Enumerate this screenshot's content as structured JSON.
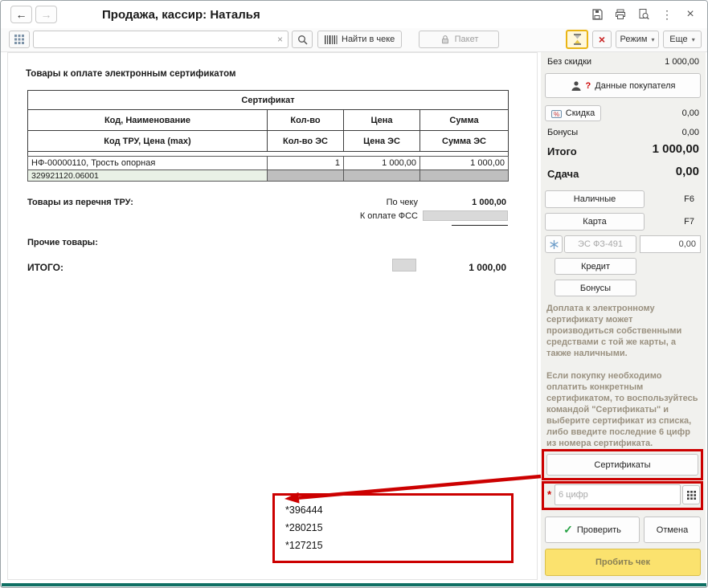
{
  "titlebar": {
    "back_glyph": "←",
    "forward_glyph": "→",
    "title": "Продажа, кассир: Наталья",
    "kebab_glyph": "⋮",
    "close_glyph": "×"
  },
  "toolbar": {
    "clear_glyph": "×",
    "find_button": "Найти в чеке",
    "package_button": "Пакет",
    "cancel_glyph": "×",
    "mode_button": "Режим",
    "more_button": "Еще",
    "dropdown_glyph": "▾"
  },
  "main": {
    "heading": "Товары к оплате электронным сертификатом",
    "table": {
      "group_header": "Сертификат",
      "header_row1": [
        "Код, Наименование",
        "Кол-во",
        "Цена",
        "Сумма"
      ],
      "header_row2": [
        "Код ТРУ, Цена (max)",
        "Кол-во ЭС",
        "Цена ЭС",
        "Сумма ЭС"
      ],
      "row": {
        "name": "НФ-00000110, Трость опорная",
        "qty": "1",
        "price": "1 000,00",
        "sum": "1 000,00"
      },
      "code_row": {
        "code": "329921120.06001"
      }
    },
    "tru_section": {
      "label": "Товары из перечня ТРУ:",
      "by_receipt_label": "По чеку",
      "by_receipt_value": "1 000,00",
      "fss_label": "К оплате ФСС"
    },
    "other_label": "Прочие товары:",
    "total": {
      "label": "ИТОГО:",
      "value": "1 000,00"
    },
    "cert_numbers": [
      "*396444",
      "*280215",
      "*127215"
    ]
  },
  "sidebar": {
    "no_discount": {
      "label": "Без скидки",
      "value": "1 000,00"
    },
    "customer_button": "Данные покупателя",
    "customer_icon_mark": "?",
    "discount": {
      "label": "Скидка",
      "value": "0,00"
    },
    "bonus": {
      "label": "Бонусы",
      "value": "0,00"
    },
    "total": {
      "label": "Итого",
      "value": "1 000,00"
    },
    "change": {
      "label": "Сдача",
      "value": "0,00"
    },
    "cash": {
      "label": "Наличные",
      "hotkey": "F6"
    },
    "card": {
      "label": "Карта",
      "hotkey": "F7"
    },
    "es": {
      "label": "ЭС ФЗ-491",
      "value": "0,00"
    },
    "credit_button": "Кредит",
    "bonuses_button": "Бонусы",
    "help1": "Доплата к электронному сертификату может производиться собственными средствами с той же карты, а также наличными.",
    "help2": "Если покупку необходимо оплатить конкретным сертификатом, то воспользуйтесь командой \"Сертификаты\" и выберите сертификат из списка, либо введите последние 6 цифр из номера сертификата.",
    "certificates_button": "Сертификаты",
    "cert_input": {
      "required_mark": "*",
      "placeholder": "6 цифр"
    },
    "check_glyph": "✓",
    "check_button": "Проверить",
    "cancel_button": "Отмена",
    "submit_button": "Пробить чек"
  },
  "colors": {
    "annotation_red": "#cc0000",
    "submit_yellow": "#fbe26e",
    "bottom_bar_teal": "#0f6f63"
  }
}
